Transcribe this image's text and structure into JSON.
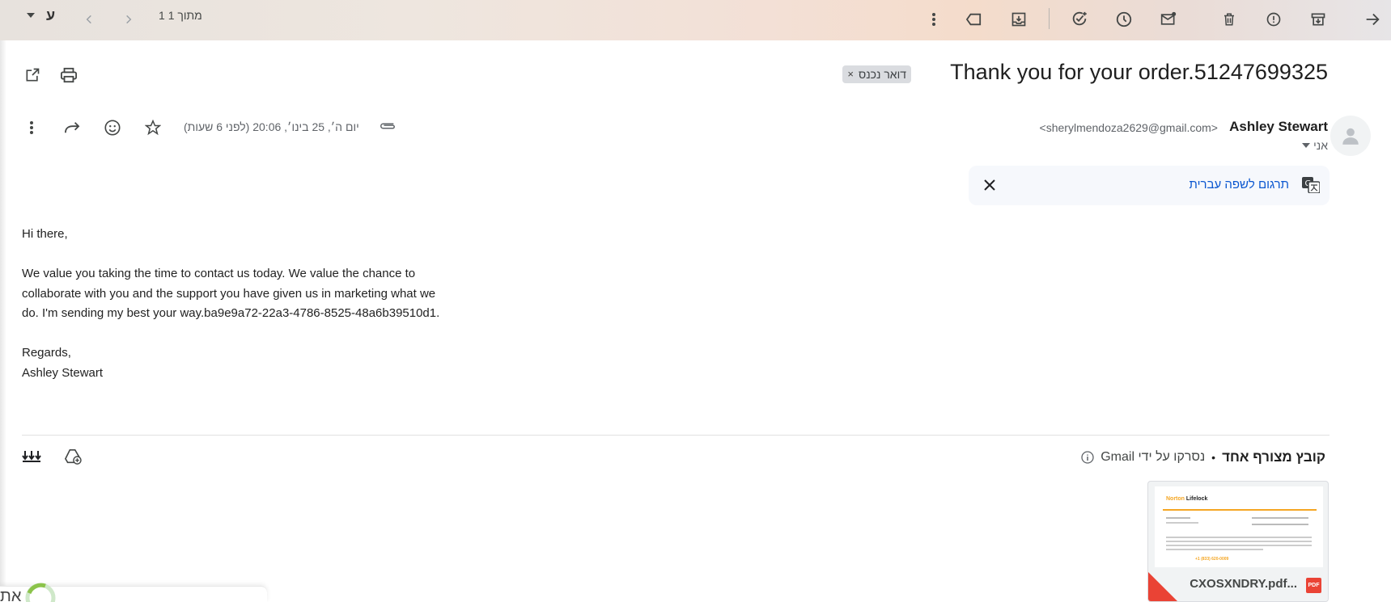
{
  "toolbar": {
    "pagination": "1 מתוך 1",
    "input_lang": "ע",
    "icons": [
      "back-arrow-icon",
      "archive-icon",
      "report-spam-icon",
      "delete-icon",
      "mark-unread-icon",
      "snooze-icon",
      "add-task-icon",
      "move-to-icon",
      "label-icon",
      "more-vert-icon",
      "older-chevron-icon",
      "newer-chevron-icon",
      "input-tools-dropdown-icon"
    ]
  },
  "message": {
    "subject": "Thank you for your order.51247699325",
    "label": "דואר נכנס",
    "label_remove": "×",
    "sender_name": "Ashley Stewart",
    "sender_email": "<sherylmendoza2629@gmail.com>",
    "to": "אני",
    "date": "יום ה׳, 25 בינו׳, 20:06 (לפני 6 שעות)"
  },
  "translate": {
    "link": "תרגום לשפה עברית"
  },
  "body": {
    "greeting": "Hi there,",
    "paragraph": "We value you taking the time to contact us today. We value the chance to collaborate with you and the support you have given us in marketing what we do. I'm sending my best your way.ba9e9a72-22a3-4786-8525-48a6b39510d1.",
    "closing": "Regards,",
    "signature": "Ashley Stewart"
  },
  "attachments": {
    "count_label": "קובץ מצורף אחד",
    "separator": "•",
    "scan_label": "נסרקו על ידי Gmail",
    "file": {
      "name": "CXOSXNDRY.pdf...",
      "type_badge": "PDF",
      "preview_brand": "Norton",
      "preview_brand2": "Lifelock",
      "preview_phone": "+1 (833) 620-0009"
    }
  },
  "bottom_widget": {
    "text": "את"
  },
  "colors": {
    "accent_blue": "#0b57d0",
    "importance_yellow": "#f6bf26",
    "pdf_red": "#ea4335",
    "norton_orange": "#f5a623"
  }
}
